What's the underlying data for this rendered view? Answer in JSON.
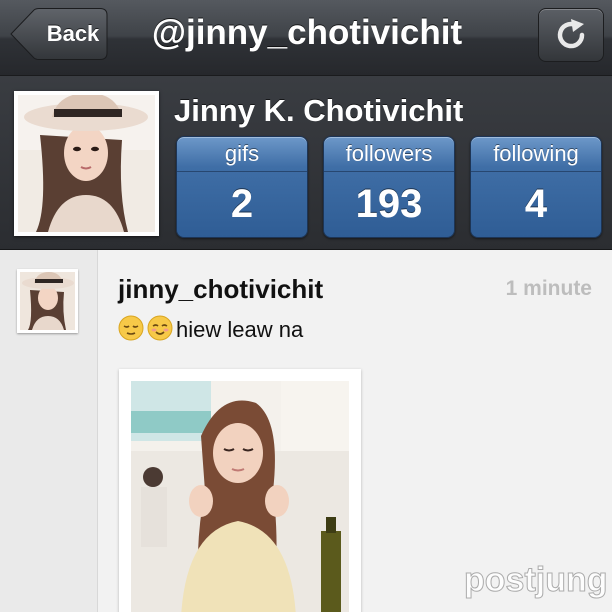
{
  "navbar": {
    "back_label": "Back",
    "title": "@jinny_chotivichit",
    "refresh_icon": "refresh-icon"
  },
  "profile": {
    "name": "Jinny K. Chotivichit",
    "stats": {
      "gifs": {
        "label": "gifs",
        "value": "2"
      },
      "followers": {
        "label": "followers",
        "value": "193"
      },
      "following": {
        "label": "following",
        "value": "4"
      }
    }
  },
  "post": {
    "username": "jinny_chotivichit",
    "time": "1 minute",
    "caption": "hiew leaw na",
    "caption_emojis": [
      "relieved-face-icon",
      "smiling-face-icon"
    ]
  },
  "watermark": {
    "text": "postjung"
  },
  "colors": {
    "navbar": "#3f4348",
    "stat_button": "#3f6ea6",
    "feed_background": "#f2f2f2",
    "timestamp": "#bdbdbd"
  }
}
